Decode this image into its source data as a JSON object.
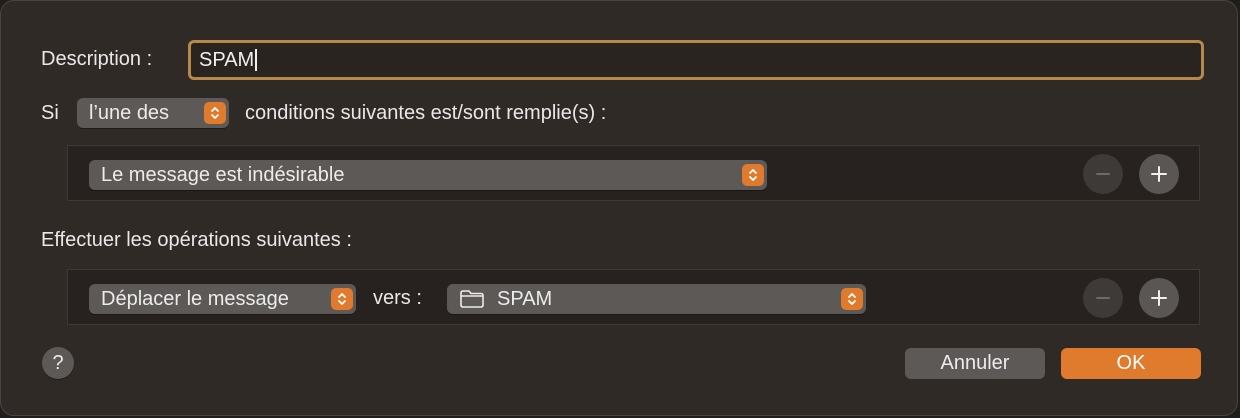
{
  "description": {
    "label": "Description :",
    "value": "SPAM"
  },
  "condition_header": {
    "prefix": "Si",
    "match_selector": "l’une des",
    "suffix": "conditions suivantes est/sont remplie(s) :"
  },
  "conditions": [
    {
      "field": "Le message est indésirable"
    }
  ],
  "actions_header": "Effectuer les opérations suivantes :",
  "actions": [
    {
      "action": "Déplacer le message",
      "connector": "vers :",
      "target": "SPAM",
      "target_icon": "folder-icon"
    }
  ],
  "help_label": "?",
  "buttons": {
    "cancel": "Annuler",
    "ok": "OK"
  },
  "colors": {
    "accent": "#e07a2c",
    "focus_ring": "#b7884a",
    "background": "#302a26"
  }
}
